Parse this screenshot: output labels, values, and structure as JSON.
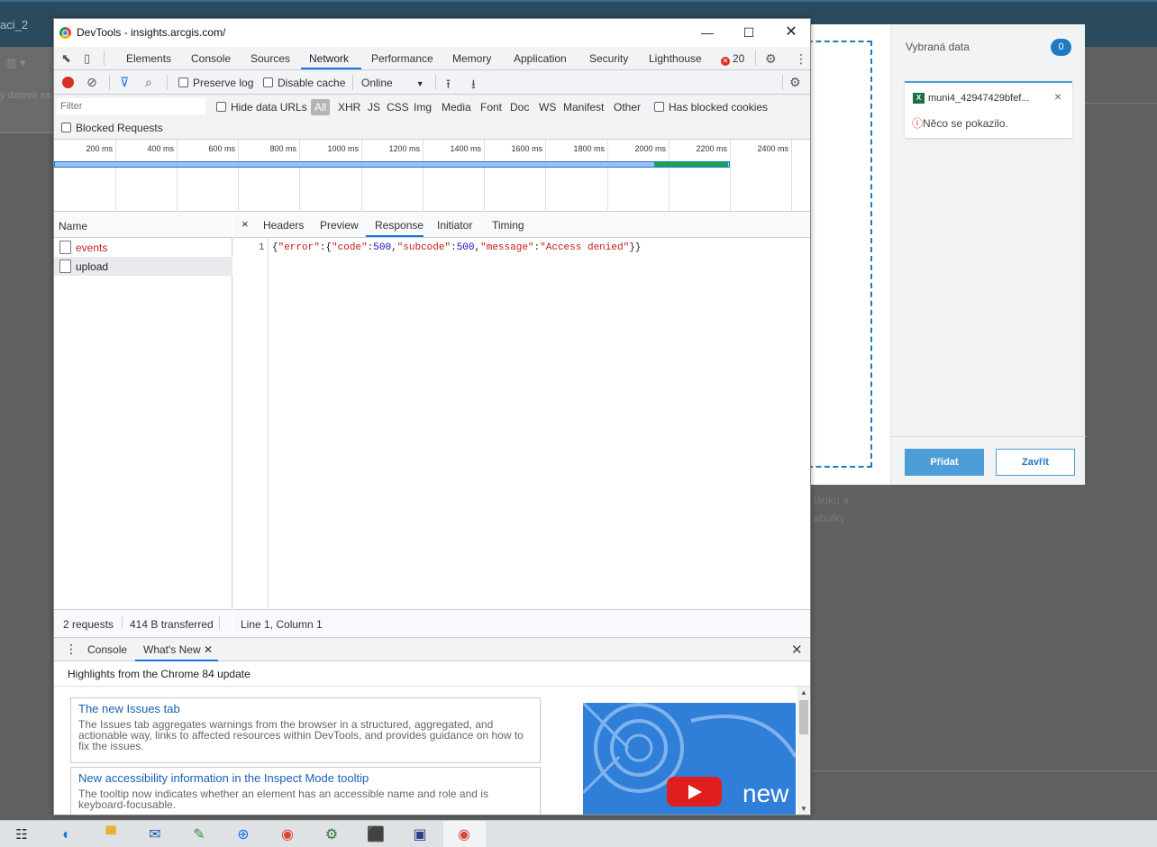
{
  "background": {
    "tab_label": "aci_2",
    "side_label": "y datové sa",
    "faint_text_1": "lánku a",
    "faint_text_2": "abulky"
  },
  "dialog": {
    "selected_title": "Vybraná data",
    "selected_count": "0",
    "file_name": "muni4_42947429bfef...",
    "file_icon": "X",
    "error_icon": "ⓘ",
    "error_text": "Něco se pokazilo.",
    "add_label": "Přidat",
    "close_label": "Zavřít"
  },
  "devtools": {
    "window_title": "DevTools - insights.arcgis.com/",
    "tabs": {
      "elements": "Elements",
      "console": "Console",
      "sources": "Sources",
      "network": "Network",
      "performance": "Performance",
      "memory": "Memory",
      "application": "Application",
      "security": "Security",
      "lighthouse": "Lighthouse"
    },
    "error_count": "20",
    "controls": {
      "preserve_log": "Preserve log",
      "disable_cache": "Disable cache",
      "throttle": "Online"
    },
    "filter": {
      "placeholder": "Filter",
      "hide_data_urls": "Hide data URLs",
      "types": [
        "All",
        "XHR",
        "JS",
        "CSS",
        "Img",
        "Media",
        "Font",
        "Doc",
        "WS",
        "Manifest",
        "Other"
      ],
      "has_blocked_cookies": "Has blocked cookies",
      "blocked_requests": "Blocked Requests"
    },
    "timeline_ticks": [
      "200 ms",
      "400 ms",
      "600 ms",
      "800 ms",
      "1000 ms",
      "1200 ms",
      "1400 ms",
      "1600 ms",
      "1800 ms",
      "2000 ms",
      "2200 ms",
      "2400 ms"
    ],
    "requests": {
      "header": "Name",
      "rows": [
        {
          "name": "events",
          "color": "#c5221f"
        },
        {
          "name": "upload",
          "color": "#202124"
        }
      ],
      "summary_requests": "2 requests",
      "summary_transferred": "414 B transferred"
    },
    "detail": {
      "close": "×",
      "tabs": {
        "headers": "Headers",
        "preview": "Preview",
        "response": "Response",
        "initiator": "Initiator",
        "timing": "Timing"
      },
      "line_number": "1",
      "response_body": "{\"error\":{\"code\":500,\"subcode\":500,\"message\":\"Access denied\"}}",
      "cursor": "Line 1, Column 1"
    },
    "drawer": {
      "console": "Console",
      "whats_new": "What's New",
      "highlights": "Highlights from the Chrome 84 update",
      "cards": [
        {
          "title": "The new Issues tab",
          "desc": "The Issues tab aggregates warnings from the browser in a structured, aggregated, and actionable way, links to affected resources within DevTools, and provides guidance on how to fix the issues."
        },
        {
          "title": "New accessibility information in the Inspect Mode tooltip",
          "desc": "The tooltip now indicates whether an element has an accessible name and role and is keyboard-focusable."
        }
      ],
      "video_text": "new"
    }
  },
  "taskbar": {
    "apps": [
      "task-view",
      "edge",
      "file-explorer",
      "mail",
      "notepad",
      "vpn-globe",
      "chrome",
      "network-tool",
      "acrobat",
      "save-disk",
      "chrome-active"
    ]
  }
}
